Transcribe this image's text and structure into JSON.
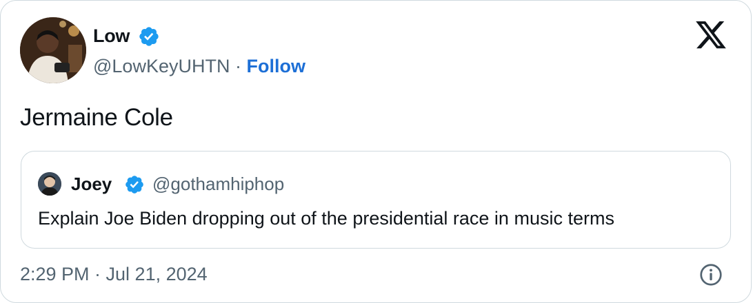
{
  "author": {
    "name": "Low",
    "handle": "@LowKeyUHTN",
    "separator": "·",
    "follow_label": "Follow"
  },
  "tweet": {
    "text": "Jermaine Cole",
    "timestamp": "2:29 PM · Jul 21, 2024"
  },
  "quoted_tweet": {
    "name": "Joey",
    "handle": "@gothamhiphop",
    "text": "Explain Joe Biden dropping out of the presidential race in music terms"
  },
  "icons": {
    "verified": "verified-badge-icon",
    "logo": "x-logo-icon",
    "info": "info-icon"
  },
  "colors": {
    "verified": "#1d9bf0",
    "link": "#1d6fd6",
    "secondary_text": "#536471",
    "border": "#cfd9de"
  }
}
